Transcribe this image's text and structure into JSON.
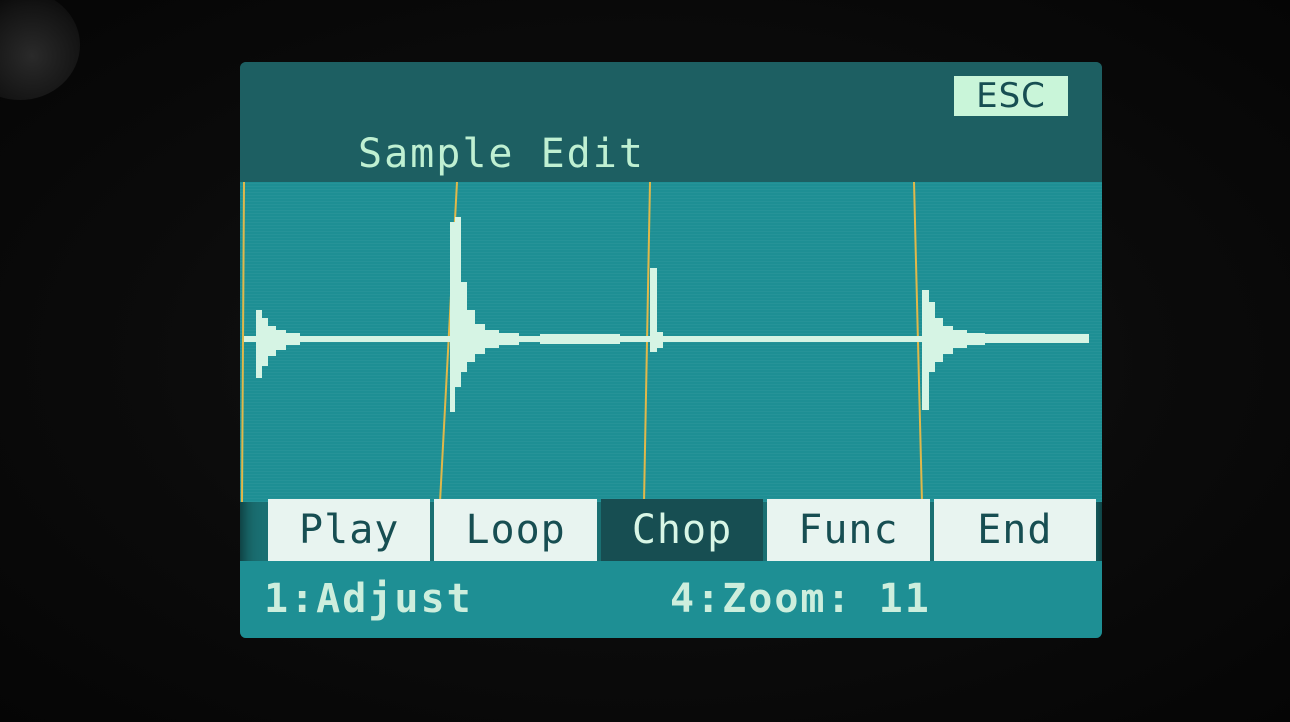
{
  "screen": {
    "title": "Sample Edit",
    "esc_label": "ESC"
  },
  "tabs": [
    {
      "label": "Play",
      "active": false
    },
    {
      "label": "Loop",
      "active": false
    },
    {
      "label": "Chop",
      "active": true
    },
    {
      "label": "Func",
      "active": false
    },
    {
      "label": "End",
      "active": false
    }
  ],
  "footer": {
    "knob1": "1:Adjust",
    "knob4": "4:Zoom: 11"
  },
  "colors": {
    "header_bg": "#1d5f62",
    "wave_bg": "#1e8f94",
    "waveform": "#d6f4e4",
    "chop_marker": "#e0b84a",
    "tab_bg": "#e8f4f0",
    "tab_active_bg": "#174e52"
  }
}
